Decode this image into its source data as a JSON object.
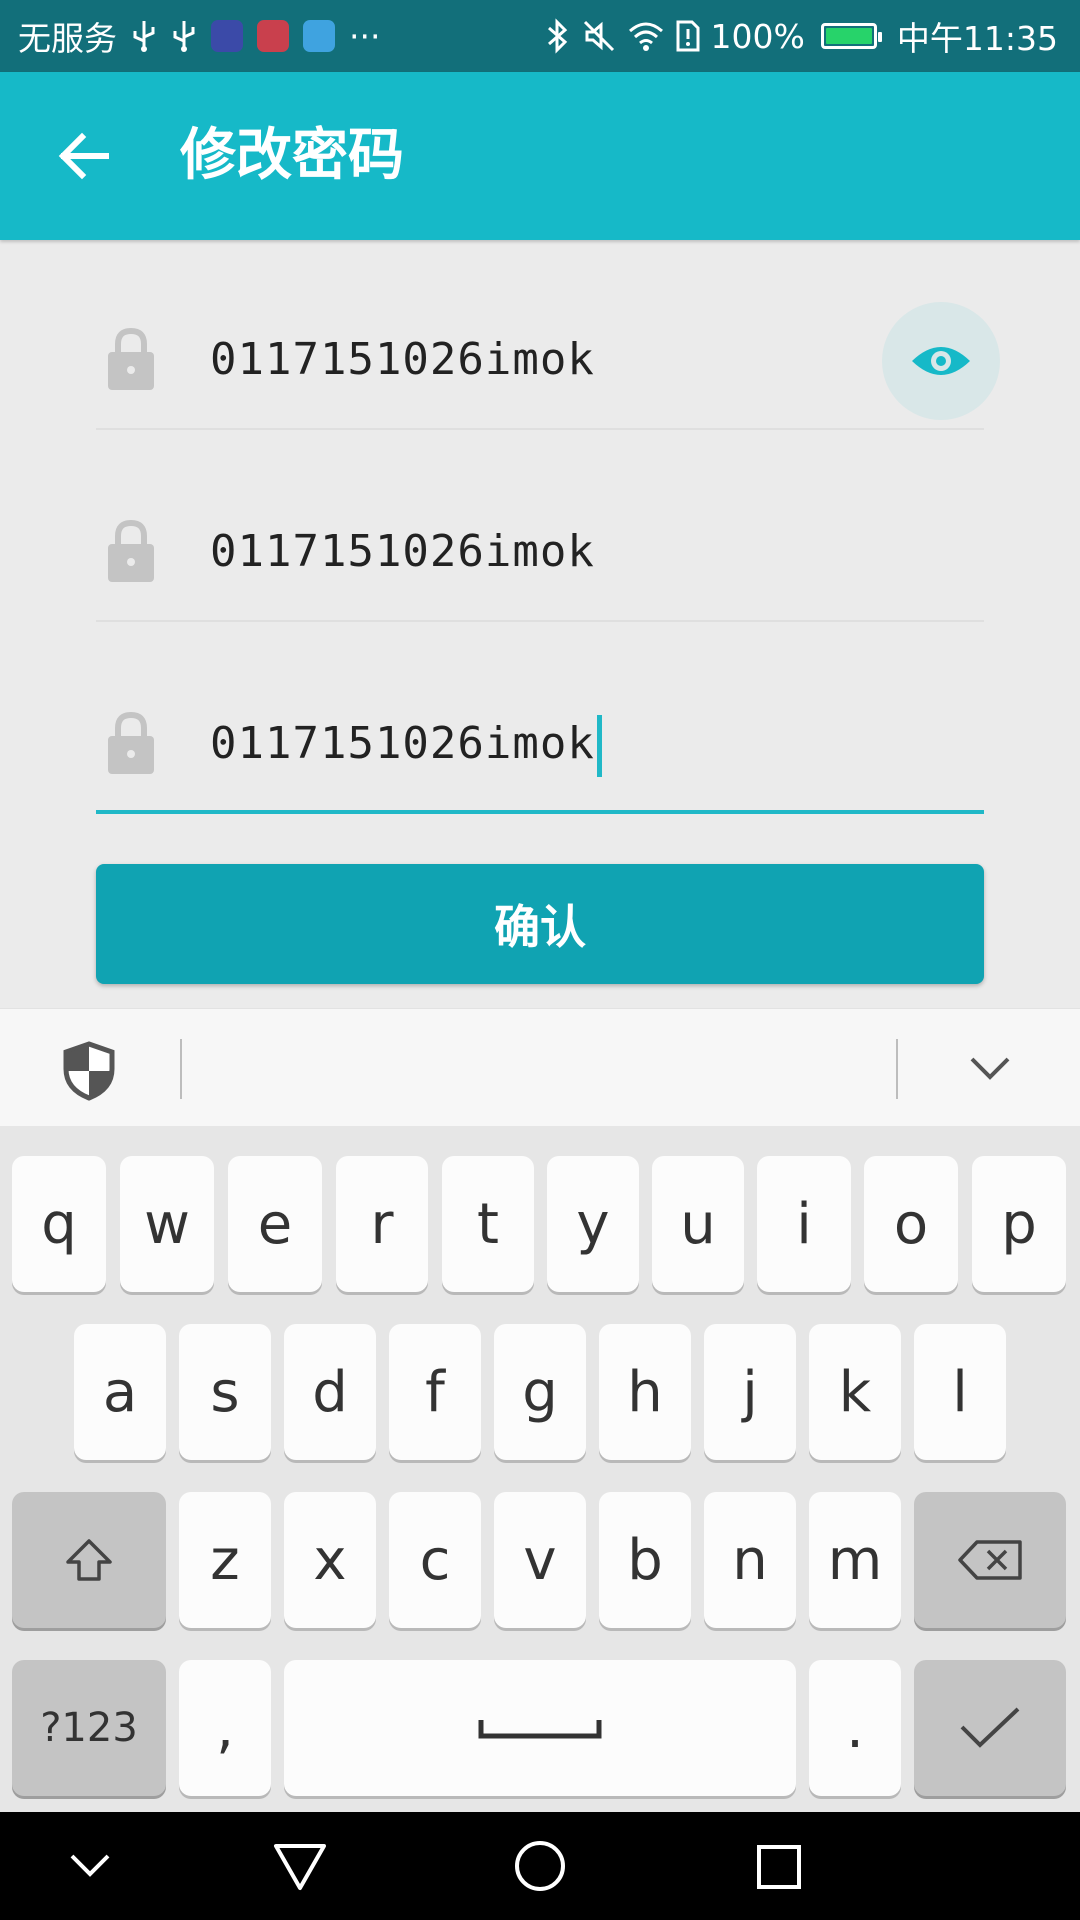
{
  "status_bar": {
    "carrier": "无服务",
    "more_indicator": "···",
    "battery_percent": "100%",
    "time": "中午11:35",
    "battery_level": 1.0,
    "icons": [
      "usb-icon",
      "usb-icon",
      "app-notification-icon",
      "app-notification-icon",
      "app-notification-icon",
      "bluetooth-icon",
      "mute-icon",
      "wifi-icon",
      "sim-alert-icon",
      "battery-charging-icon"
    ]
  },
  "toolbar": {
    "title": "修改密码",
    "back_icon": "arrow-left-icon"
  },
  "form": {
    "fields": [
      {
        "value": "0117151026imok",
        "icon": "lock-icon"
      },
      {
        "value": "0117151026imok",
        "icon": "lock-icon"
      },
      {
        "value": "0117151026imok",
        "icon": "lock-icon"
      }
    ],
    "toggle_icon": "eye-icon",
    "confirm_label": "确认"
  },
  "keyboard": {
    "row1": [
      "q",
      "w",
      "e",
      "r",
      "t",
      "y",
      "u",
      "i",
      "o",
      "p"
    ],
    "row2": [
      "a",
      "s",
      "d",
      "f",
      "g",
      "h",
      "j",
      "k",
      "l"
    ],
    "row3": [
      "z",
      "x",
      "c",
      "v",
      "b",
      "n",
      "m"
    ],
    "symbols_label": "?123",
    "comma": ",",
    "period": ".",
    "toolbar_icons": [
      "shield-icon",
      "chevron-down-icon"
    ]
  },
  "colors": {
    "status_bar": "#126f7a",
    "toolbar": "#16b9c8",
    "accent": "#20b8c7",
    "button": "#10a3b2"
  }
}
